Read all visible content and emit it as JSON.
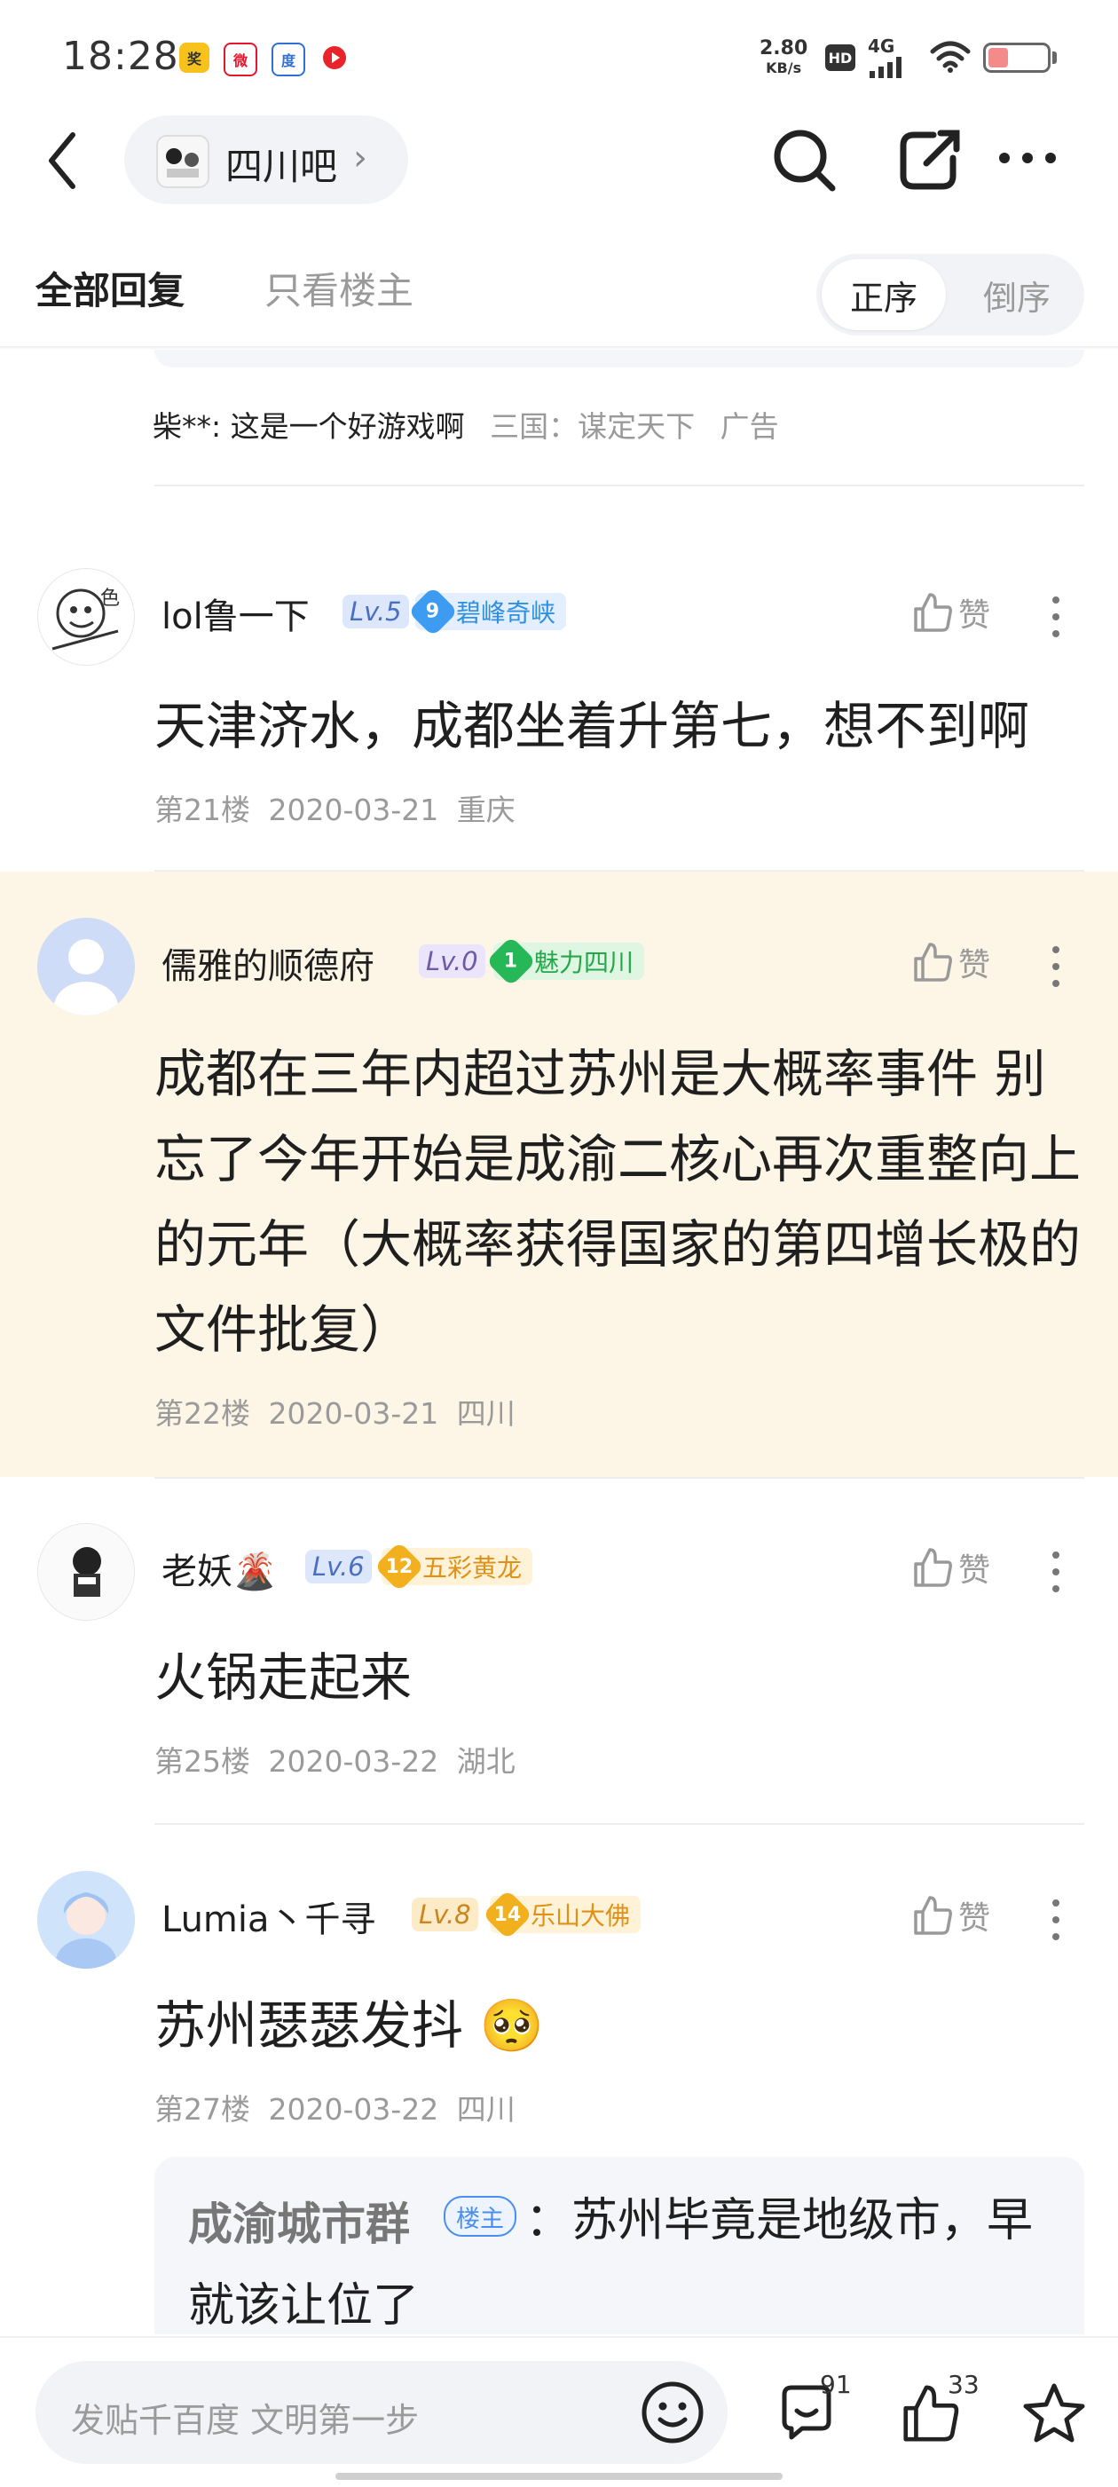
{
  "status_bar": {
    "time": "18:28",
    "net_speed_value": "2.80",
    "net_speed_unit": "KB/s",
    "hd": "HD",
    "signal": "4G",
    "app_icons": [
      "jiangxiang-app-icon",
      "weibo-icon",
      "baidu-icon",
      "video-app-icon"
    ],
    "battery_level": 0.35
  },
  "nav": {
    "forum_name": "四川吧",
    "chevron": "›"
  },
  "tabs": {
    "all_replies": "全部回复",
    "op_only": "只看楼主",
    "sort_asc": "正序",
    "sort_desc": "倒序"
  },
  "ad_line": {
    "user": "柴**: 这是一个好游戏啊",
    "game": "三国：谋定天下",
    "ad_label": "广告"
  },
  "posts": [
    {
      "username": "lol鲁一下",
      "level": "Lv.5",
      "badge_num": "9",
      "badge_label": "碧峰奇峡",
      "content": "天津济水，成都坐着升第七，想不到啊",
      "floor": "第21楼",
      "date": "2020-03-21",
      "location": "重庆",
      "like_label": "赞"
    },
    {
      "username": "儒雅的顺德府",
      "level": "Lv.0",
      "badge_num": "1",
      "badge_label": "魅力四川",
      "content": "成都在三年内超过苏州是大概率事件 别忘了今年开始是成渝二核心再次重整向上的元年（大概率获得国家的第四增长极的文件批复）",
      "floor": "第22楼",
      "date": "2020-03-21",
      "location": "四川",
      "like_label": "赞"
    },
    {
      "username": "老妖🌋",
      "level": "Lv.6",
      "badge_num": "12",
      "badge_label": "五彩黄龙",
      "content": "火锅走起来",
      "floor": "第25楼",
      "date": "2020-03-22",
      "location": "湖北",
      "like_label": "赞"
    },
    {
      "username": "Lumia丶千寻",
      "level": "Lv.8",
      "badge_num": "14",
      "badge_label": "乐山大佛",
      "content": "苏州瑟瑟发抖",
      "emoji": "🥺",
      "floor": "第27楼",
      "date": "2020-03-22",
      "location": "四川",
      "like_label": "赞"
    }
  ],
  "sub_reply": {
    "author": "成渝城市群",
    "op_badge": "楼主",
    "text": "：苏州毕竟是地级市，早就该让位了"
  },
  "bottom_bar": {
    "placeholder": "发贴千百度 文明第一步",
    "comment_count": "91",
    "like_count": "33"
  }
}
